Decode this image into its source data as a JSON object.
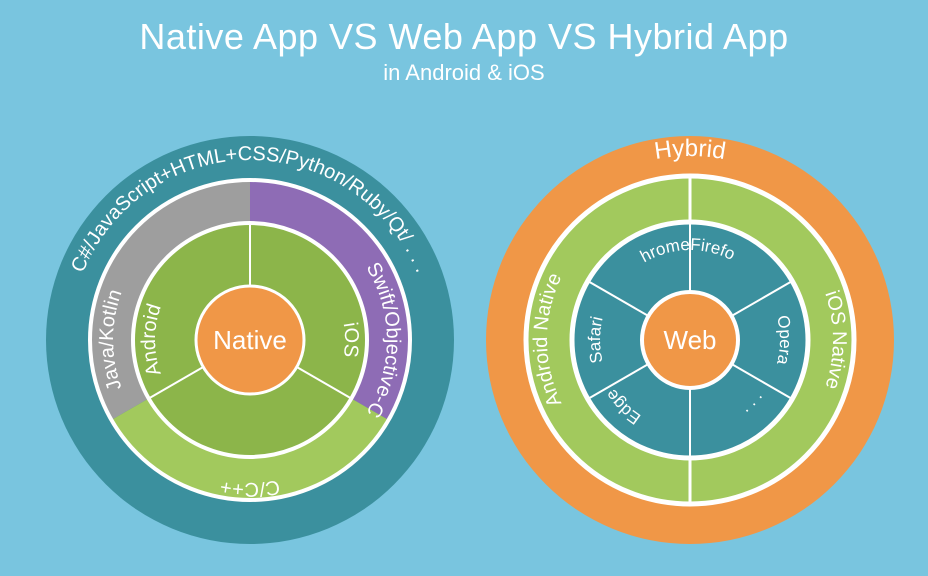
{
  "header": {
    "title": "Native App VS Web App VS Hybrid App",
    "subtitle": "in Android & iOS"
  },
  "colors": {
    "bg": "#79c5df",
    "orange": "#f09747",
    "teal": "#3b909e",
    "purple": "#8e6cb5",
    "gray": "#9e9e9e",
    "greenDark": "#8cb54a",
    "greenLight": "#a2c95d",
    "white": "#ffffff"
  },
  "chart_data": [
    {
      "type": "sunburst",
      "center_label": "Native",
      "rings": [
        {
          "level": 1,
          "segments": [
            {
              "label": "Android",
              "fraction": 0.333,
              "color": "greenDark"
            },
            {
              "label": "iOS",
              "fraction": 0.333,
              "color": "greenDark"
            },
            {
              "label": "",
              "fraction": 0.334,
              "color": "greenDark"
            }
          ]
        },
        {
          "level": 2,
          "segments": [
            {
              "label": "Java/Kotlin",
              "fraction": 0.333,
              "color": "gray"
            },
            {
              "label": "Swift/Objective-C",
              "fraction": 0.333,
              "color": "purple"
            },
            {
              "label": "C/C++",
              "fraction": 0.334,
              "color": "greenLight"
            }
          ]
        },
        {
          "level": 3,
          "segments": [
            {
              "label": "C#/JavaScript+HTML+CSS/Python/Ruby/Qt/ . . .",
              "fraction": 1.0,
              "color": "teal"
            }
          ]
        }
      ]
    },
    {
      "type": "sunburst",
      "center_label": "Web",
      "rings": [
        {
          "level": 1,
          "segments": [
            {
              "label": "Chrome",
              "fraction": 0.1667,
              "color": "teal"
            },
            {
              "label": "Firefox",
              "fraction": 0.1667,
              "color": "teal"
            },
            {
              "label": "Opera",
              "fraction": 0.1667,
              "color": "teal"
            },
            {
              "label": ". . .",
              "fraction": 0.1667,
              "color": "teal"
            },
            {
              "label": "Edge",
              "fraction": 0.1667,
              "color": "teal"
            },
            {
              "label": "Safari",
              "fraction": 0.1667,
              "color": "teal"
            }
          ]
        },
        {
          "level": 2,
          "segments": [
            {
              "label": "Android Native",
              "fraction": 0.5,
              "color": "greenLight"
            },
            {
              "label": "iOS Native",
              "fraction": 0.5,
              "color": "greenLight"
            }
          ]
        },
        {
          "level": 3,
          "segments": [
            {
              "label": "Hybrid",
              "fraction": 1.0,
              "color": "orange"
            }
          ]
        }
      ]
    }
  ]
}
